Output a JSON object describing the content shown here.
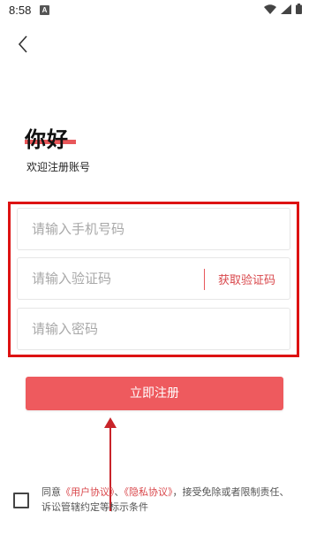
{
  "status_bar": {
    "time": "8:58",
    "notification_letter": "A"
  },
  "header": {
    "title": "你好",
    "subtitle": "欢迎注册账号"
  },
  "form": {
    "phone_placeholder": "请输入手机号码",
    "code_placeholder": "请输入验证码",
    "get_code_label": "获取验证码",
    "password_placeholder": "请输入密码"
  },
  "register_button_label": "立即注册",
  "agreement": {
    "prefix": "同意",
    "user_agreement": "《用户协议》",
    "separator": "、",
    "privacy_agreement": "《隐私协议》",
    "suffix": "，接受免除或者限制责任、诉讼管辖约定等标示条件"
  },
  "colors": {
    "accent": "#ee5a5e",
    "annotation_red": "#dd1212"
  }
}
